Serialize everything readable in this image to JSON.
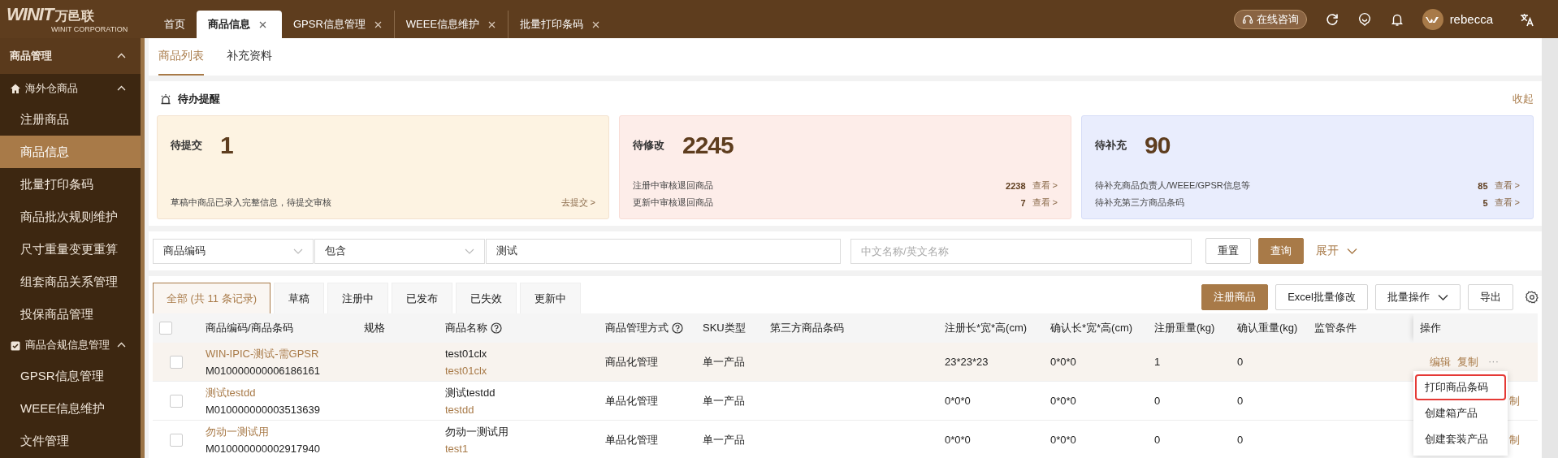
{
  "header": {
    "logo": {
      "brand": "WINIT",
      "name_cn": "万邑联",
      "tagline": "WINIT CORPORATION"
    },
    "tabs": [
      {
        "label": "首页",
        "selected": false,
        "closable": false
      },
      {
        "label": "商品信息",
        "selected": true,
        "closable": true
      },
      {
        "label": "GPSR信息管理",
        "selected": false,
        "closable": true
      },
      {
        "label": "WEEE信息维护",
        "selected": false,
        "closable": true
      },
      {
        "label": "批量打印条码",
        "selected": false,
        "closable": true
      }
    ],
    "consult": "在线咨询",
    "user": "rebecca"
  },
  "sidebar": {
    "title": "商品管理",
    "expanded": true,
    "children": [
      {
        "label": "海外仓商品",
        "kind": "home",
        "expanded": true,
        "children": [
          {
            "label": "注册商品",
            "selected": false
          },
          {
            "label": "商品信息",
            "selected": true
          },
          {
            "label": "批量打印条码",
            "selected": false
          },
          {
            "label": "商品批次规则维护",
            "selected": false
          },
          {
            "label": "尺寸重量变更重算",
            "selected": false
          },
          {
            "label": "组套商品关系管理",
            "selected": false
          },
          {
            "label": "投保商品管理",
            "selected": false
          }
        ]
      },
      {
        "label": "商品合规信息管理",
        "kind": "clipboard",
        "expanded": true,
        "children": [
          {
            "label": "GPSR信息管理",
            "selected": false
          },
          {
            "label": "WEEE信息维护",
            "selected": false
          },
          {
            "label": "文件管理",
            "selected": false
          }
        ]
      }
    ]
  },
  "subtabs": [
    {
      "label": "商品列表",
      "selected": true
    },
    {
      "label": "补充资料",
      "selected": false
    }
  ],
  "reminders": {
    "title": "待办提醒",
    "toggle": "收起",
    "cards": [
      {
        "label": "待提交",
        "count": "1",
        "color": "#fdf3e2",
        "lines": [
          {
            "text": "草稿中商品已录入完整信息，待提交审核",
            "link": "去提交 >"
          }
        ]
      },
      {
        "label": "待修改",
        "count": "2245",
        "color": "#fdede9",
        "lines": [
          {
            "text": "注册中审核退回商品",
            "count": "2238",
            "link": "查看 >"
          },
          {
            "text": "更新中审核退回商品",
            "count": "7",
            "link": "查看 >"
          }
        ]
      },
      {
        "label": "待补充",
        "count": "90",
        "color": "#e9edfd",
        "lines": [
          {
            "text": "待补充商品负责人/WEEE/GPSR信息等",
            "count": "85",
            "link": "查看 >"
          },
          {
            "text": "待补充第三方商品条码",
            "count": "5",
            "link": "查看 >"
          }
        ]
      }
    ]
  },
  "filter": {
    "field": "商品编码",
    "operator": "包含",
    "value": "测试",
    "name_placeholder": "中文名称/英文名称",
    "reset": "重置",
    "search": "查询",
    "expand": "展开"
  },
  "status_tabs": [
    {
      "label": "全部 (共 11 条记录)",
      "selected": true
    },
    {
      "label": "草稿",
      "selected": false
    },
    {
      "label": "注册中",
      "selected": false
    },
    {
      "label": "已发布",
      "selected": false
    },
    {
      "label": "已失效",
      "selected": false
    },
    {
      "label": "更新中",
      "selected": false
    }
  ],
  "toolbar": [
    {
      "label": "注册商品",
      "kind": "primary"
    },
    {
      "label": "Excel批量修改",
      "kind": "plain"
    },
    {
      "label": "批量操作",
      "kind": "dropdown"
    },
    {
      "label": "导出",
      "kind": "plain"
    }
  ],
  "table": {
    "all_checked": false,
    "columns": [
      {
        "label": "商品编码/商品条码",
        "help": false
      },
      {
        "label": "规格",
        "help": false
      },
      {
        "label": "商品名称",
        "help": true
      },
      {
        "label": "商品管理方式",
        "help": true
      },
      {
        "label": "SKU类型",
        "help": false
      },
      {
        "label": "第三方商品条码",
        "help": false
      },
      {
        "label": "注册长*宽*高(cm)",
        "help": false
      },
      {
        "label": "确认长*宽*高(cm)",
        "help": false
      },
      {
        "label": "注册重量(kg)",
        "help": false
      },
      {
        "label": "确认重量(kg)",
        "help": false
      },
      {
        "label": "监管条件",
        "help": false
      },
      {
        "label": "操作",
        "help": false
      }
    ],
    "rows": [
      {
        "checked": false,
        "hovered": true,
        "covered": false,
        "code": "WIN-IPIC-测试-需GPSR",
        "barcode": "M010000000006186161",
        "name": "test01clx",
        "name_en": "test01clx",
        "management": "商品化管理",
        "sku_type": "单一产品",
        "reg_dims": "23*23*23",
        "conf_dims": "0*0*0",
        "reg_weight": "1",
        "conf_weight": "0",
        "actions": [
          "编辑",
          "复制",
          "···"
        ]
      },
      {
        "checked": false,
        "hovered": false,
        "covered": true,
        "code": "测试testdd",
        "barcode": "M010000000003513639",
        "name": "测试testdd",
        "name_en": "testdd",
        "management": "单品化管理",
        "sku_type": "单一产品",
        "reg_dims": "0*0*0",
        "conf_dims": "0*0*0",
        "reg_weight": "0",
        "conf_weight": "0",
        "actions": [
          "制"
        ]
      },
      {
        "checked": false,
        "hovered": false,
        "covered": true,
        "code": "勿动一测试用",
        "barcode": "M010000000002917940",
        "name": "勿动一测试用",
        "name_en": "test1",
        "management": "单品化管理",
        "sku_type": "单一产品",
        "reg_dims": "0*0*0",
        "conf_dims": "0*0*0",
        "reg_weight": "0",
        "conf_weight": "0",
        "actions": [
          "制"
        ]
      }
    ]
  },
  "row_menu": {
    "items": [
      {
        "label": "打印商品条码",
        "highlighted": true
      },
      {
        "label": "创建箱产品",
        "highlighted": false
      },
      {
        "label": "创建套装产品",
        "highlighted": false
      }
    ]
  }
}
